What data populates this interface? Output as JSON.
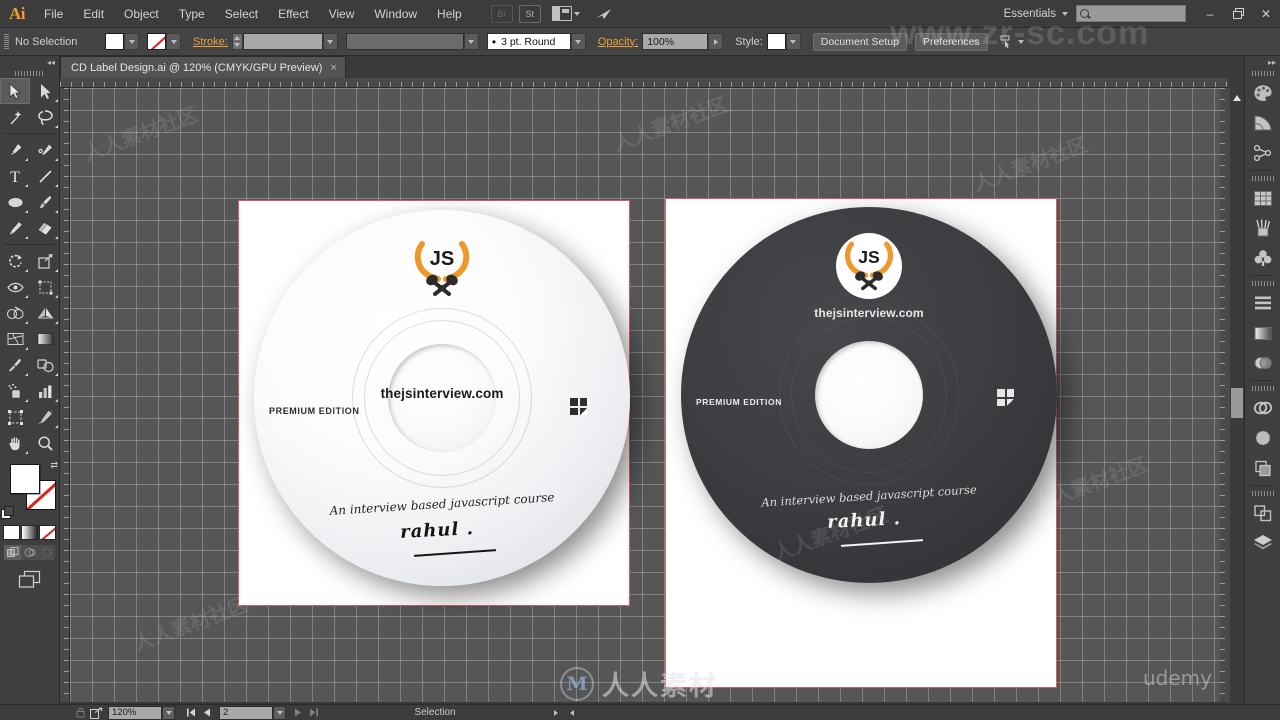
{
  "app": {
    "name": "Adobe Illustrator",
    "logo_text": "Ai"
  },
  "menubar": {
    "items": [
      {
        "label": "File"
      },
      {
        "label": "Edit"
      },
      {
        "label": "Object"
      },
      {
        "label": "Type"
      },
      {
        "label": "Select"
      },
      {
        "label": "Effect"
      },
      {
        "label": "View"
      },
      {
        "label": "Window"
      },
      {
        "label": "Help"
      }
    ],
    "bridge_label": "Br",
    "stock_label": "St",
    "workspace": "Essentials",
    "search_placeholder": "",
    "search_value": "",
    "window_minimize": "–",
    "window_restore": "❐",
    "window_close": "✕"
  },
  "controlbar": {
    "selection_status": "No Selection",
    "stroke_label": "Stroke:",
    "stroke_weight": "",
    "stroke_profile": "",
    "brush_definition": "3 pt. Round",
    "opacity_label": "Opacity:",
    "opacity_value": "100%",
    "style_label": "Style:",
    "document_setup": "Document Setup",
    "preferences": "Preferences"
  },
  "tabbar": {
    "document_title": "CD Label  Design.ai @ 120% (CMYK/GPU Preview)",
    "close_glyph": "×"
  },
  "toolbar": {
    "tools": [
      {
        "name": "selection-tool",
        "selected": true
      },
      {
        "name": "direct-selection-tool",
        "selected": false
      },
      {
        "name": "magic-wand-tool",
        "selected": false
      },
      {
        "name": "lasso-tool",
        "selected": false
      },
      {
        "name": "pen-tool",
        "selected": false
      },
      {
        "name": "curvature-tool",
        "selected": false
      },
      {
        "name": "type-tool",
        "selected": false
      },
      {
        "name": "line-segment-tool",
        "selected": false
      },
      {
        "name": "ellipse-tool",
        "selected": false
      },
      {
        "name": "paintbrush-tool",
        "selected": false
      },
      {
        "name": "pencil-tool",
        "selected": false
      },
      {
        "name": "eraser-tool",
        "selected": false
      },
      {
        "name": "rotate-tool",
        "selected": false
      },
      {
        "name": "scale-tool",
        "selected": false
      },
      {
        "name": "width-tool",
        "selected": false
      },
      {
        "name": "free-transform-tool",
        "selected": false
      },
      {
        "name": "shape-builder-tool",
        "selected": false
      },
      {
        "name": "perspective-grid-tool",
        "selected": false
      },
      {
        "name": "mesh-tool",
        "selected": false
      },
      {
        "name": "gradient-tool",
        "selected": false
      },
      {
        "name": "eyedropper-tool",
        "selected": false
      },
      {
        "name": "blend-tool",
        "selected": false
      },
      {
        "name": "symbol-sprayer-tool",
        "selected": false
      },
      {
        "name": "column-graph-tool",
        "selected": false
      },
      {
        "name": "artboard-tool",
        "selected": false
      },
      {
        "name": "slice-tool",
        "selected": false
      },
      {
        "name": "hand-tool",
        "selected": false
      },
      {
        "name": "zoom-tool",
        "selected": false
      }
    ],
    "fill_color": "#ffffff",
    "stroke_color": "none",
    "color_mode": "color",
    "drawing_mode": "draw-normal"
  },
  "dock": {
    "panels": [
      {
        "name": "color-panel"
      },
      {
        "name": "color-guide-panel"
      },
      {
        "name": "libraries-panel"
      },
      {
        "name": "properties-panel"
      },
      {
        "name": "brushes-panel"
      },
      {
        "name": "symbols-panel"
      },
      {
        "name": "align-panel"
      },
      {
        "name": "gradient-panel"
      },
      {
        "name": "transparency-panel"
      },
      {
        "name": "creative-cloud-panel"
      },
      {
        "name": "image-trace-panel"
      },
      {
        "name": "pathfinder-panel"
      },
      {
        "name": "artboards-panel"
      },
      {
        "name": "layers-panel"
      }
    ]
  },
  "statusbar": {
    "zoom_level": "120%",
    "artboard_number": "2",
    "status_text": "Selection"
  },
  "artwork": {
    "cd_left": {
      "theme": "white",
      "logo_text": "JS",
      "url": "thejsinterview.com",
      "edition": "PREMIUM EDITION",
      "tagline": "An interview based javascript course",
      "signature": "rahul .",
      "wreath_color": "#f0972c",
      "text_color": "#1f1f1f"
    },
    "cd_right": {
      "theme": "dark",
      "logo_text": "JS",
      "url": "thejsinterview.com",
      "edition": "PREMIUM EDITION",
      "tagline": "An interview based javascript course",
      "signature": "rahul .",
      "wreath_color": "#f0972c",
      "text_color": "#e6e6e6",
      "disc_color": "#3a3c3f"
    }
  },
  "watermarks": {
    "site": "www.zr-sc.com",
    "brand_cn": "人人素材",
    "brand_mark": "M",
    "platform": "udemy",
    "tile": "人人素材社区"
  },
  "colors": {
    "accent_orange": "#f79b2e",
    "artboard_border": "#e05a5a",
    "chrome_bg": "#3c3c3c",
    "canvas_bg": "#565656"
  }
}
